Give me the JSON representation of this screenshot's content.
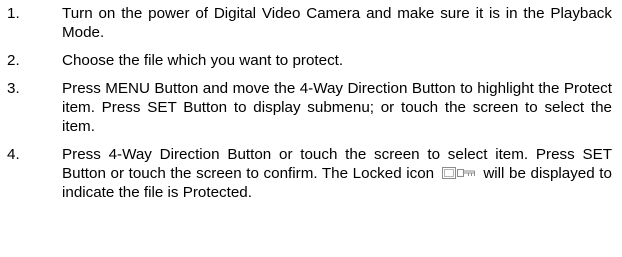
{
  "steps": [
    {
      "number": "1.",
      "text": "Turn on the power of Digital Video Camera and make sure it is in the Playback Mode."
    },
    {
      "number": "2.",
      "text": "Choose the file which you want to protect."
    },
    {
      "number": "3.",
      "text": "Press MENU Button and move the 4-Way Direction Button to highlight the Protect item.  Press SET Button to display submenu; or touch the screen to select the item."
    },
    {
      "number": "4.",
      "text_before_icon": "Press 4-Way Direction Button or touch the screen to select item.  Press SET Button or touch the screen to confirm.  The Locked icon",
      "icon": "locked-key-icon",
      "text_after_icon": "will be displayed to indicate the file is Protected."
    }
  ]
}
